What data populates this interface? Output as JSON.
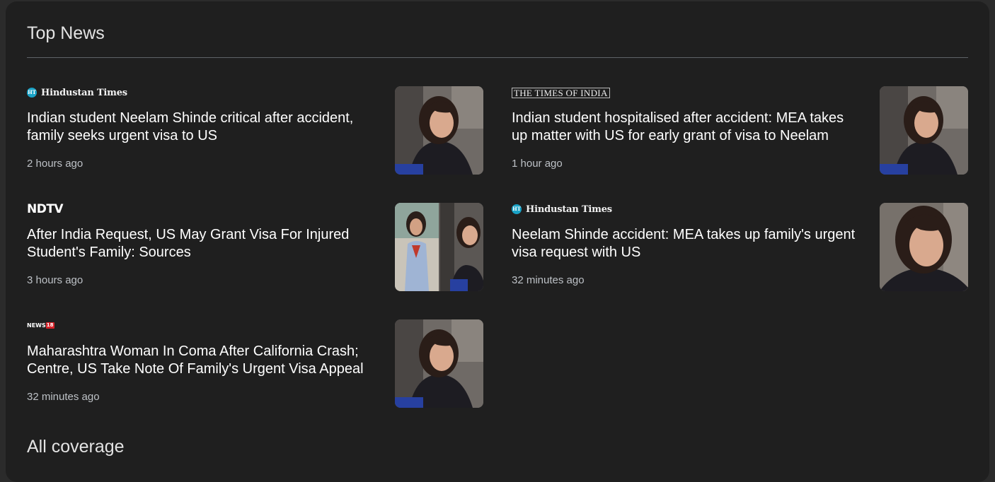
{
  "section": {
    "title": "Top News",
    "footer_title": "All coverage"
  },
  "stories": [
    {
      "source": "Hindustan Times",
      "source_badge": "HT",
      "headline": "Indian student Neelam Shinde critical after accident, family seeks urgent visa to US",
      "time": "2 hours ago",
      "thumb": "portrait-car"
    },
    {
      "source": "THE TIMES OF INDIA",
      "headline": "Indian student hospitalised after accident: MEA takes up matter with US for early grant of visa to Neelam",
      "time": "1 hour ago",
      "thumb": "portrait-car"
    },
    {
      "source": "NDTV",
      "headline": "After India Request, US May Grant Visa For Injured Student's Family: Sources",
      "time": "3 hours ago",
      "thumb": "collage"
    },
    {
      "source": "Hindustan Times",
      "source_badge": "HT",
      "headline": "Neelam Shinde accident: MEA takes up family's urgent visa request with US",
      "time": "32 minutes ago",
      "thumb": "portrait-close"
    },
    {
      "source_text": "NEWS",
      "source_num": "18",
      "headline": "Maharashtra Woman In Coma After California Crash; Centre, US Take Note Of Family's Urgent Visa Appeal",
      "time": "32 minutes ago",
      "thumb": "portrait-car"
    }
  ],
  "colors": {
    "background": "#1f1f1f",
    "headline": "#ffffff",
    "timestamp": "#bdc1c6",
    "divider": "#5f6368"
  }
}
